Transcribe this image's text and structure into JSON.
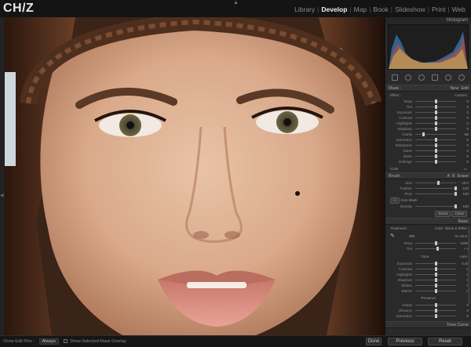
{
  "app": {
    "logo": "CH/Z",
    "modules": [
      {
        "label": "Library",
        "active": false
      },
      {
        "label": "Develop",
        "active": true
      },
      {
        "label": "Map",
        "active": false
      },
      {
        "label": "Book",
        "active": false
      },
      {
        "label": "Slideshow",
        "active": false
      },
      {
        "label": "Print",
        "active": false
      },
      {
        "label": "Web",
        "active": false
      }
    ],
    "top_panel_arrow_icon": "triangle-up-icon",
    "left_panel_arrow_icon": "triangle-left-icon"
  },
  "panel": {
    "histogram_title": "Histogram",
    "tool_icons": [
      "crop-icon",
      "spot-removal-icon",
      "red-eye-icon",
      "graduated-filter-icon",
      "radial-filter-icon",
      "adjustment-brush-icon"
    ],
    "brush": {
      "header_left": "Mask :",
      "header_mid": "New",
      "header_right": "Edit",
      "effect_label": "Effect :",
      "effect_value": "Custom",
      "sliders": [
        {
          "label": "Temp",
          "value": "0"
        },
        {
          "label": "Tint",
          "value": "0"
        },
        {
          "label": "Exposure",
          "value": "0"
        },
        {
          "label": "Contrast",
          "value": "0"
        },
        {
          "label": "Highlights",
          "value": "0"
        },
        {
          "label": "Shadows",
          "value": "0"
        },
        {
          "label": "Clarity",
          "value": "-65"
        },
        {
          "label": "Saturation",
          "value": "0"
        },
        {
          "label": "Sharpness",
          "value": "0"
        },
        {
          "label": "Noise",
          "value": "0"
        },
        {
          "label": "Moire",
          "value": "0"
        },
        {
          "label": "Defringe",
          "value": "0"
        }
      ],
      "color_label": "Color",
      "brush_header_left": "Brush :",
      "brush_header_a": "A",
      "brush_header_b": "B",
      "brush_header_erase": "Erase",
      "brush_sliders": [
        {
          "label": "Size",
          "value": "10.0"
        },
        {
          "label": "Feather",
          "value": "100"
        },
        {
          "label": "Flow",
          "value": "100"
        }
      ],
      "auto_mask_label": "Auto Mask",
      "density_label": "Density",
      "density_value": "100",
      "reset_label": "Reset",
      "close_label": "Close"
    },
    "basic": {
      "title": "Basic",
      "treatment_label": "Treatment :",
      "treatment_color": "Color",
      "treatment_bw": "Black & White",
      "wb_label": "WB :",
      "wb_value": "As Shot",
      "wb_sliders": [
        {
          "label": "Temp",
          "value": "5200"
        },
        {
          "label": "Tint",
          "value": "+ 6"
        }
      ],
      "tone_label": "Tone",
      "tone_auto": "Auto",
      "tone_sliders": [
        {
          "label": "Exposure",
          "value": "0.00"
        },
        {
          "label": "Contrast",
          "value": "0"
        },
        {
          "label": "Highlights",
          "value": "0"
        },
        {
          "label": "Shadows",
          "value": "0"
        },
        {
          "label": "Whites",
          "value": "0"
        },
        {
          "label": "Blacks",
          "value": "0"
        }
      ],
      "presence_label": "Presence",
      "presence_sliders": [
        {
          "label": "Clarity",
          "value": "0"
        },
        {
          "label": "Vibrance",
          "value": "0"
        },
        {
          "label": "Saturation",
          "value": "0"
        }
      ]
    },
    "tone_curve_title": "Tone Curve"
  },
  "bottom": {
    "show_edit_pins": "Show Edit Pins :",
    "edit_pins_value": "Always",
    "show_overlay": "Show Selected Mask Overlay",
    "done_button": "Done",
    "previous_button": "Previous",
    "reset_button": "Reset"
  },
  "colors": {
    "panel_bg": "#2a2a2a",
    "active_module": "#f0f0f0",
    "chrome_dark": "#141414"
  }
}
